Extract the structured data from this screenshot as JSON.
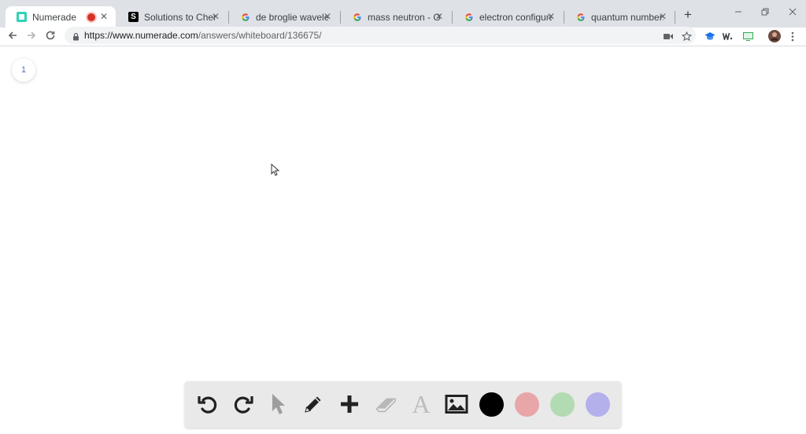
{
  "browser": {
    "tabs": [
      {
        "title": "Numerade",
        "favicon": "numerade-icon",
        "favicon_color": "#2ed3b7",
        "active": true,
        "recording": true
      },
      {
        "title": "Solutions to Chemistry",
        "favicon": "slader-icon",
        "favicon_color": "#000000"
      },
      {
        "title": "de broglie wavelength",
        "favicon": "google-icon"
      },
      {
        "title": "mass neutron - Google",
        "favicon": "google-icon"
      },
      {
        "title": "electron configuration",
        "favicon": "google-icon"
      },
      {
        "title": "quantum numbers - Go",
        "favicon": "google-icon"
      }
    ],
    "new_tab_label": "+",
    "close_glyph": "✕",
    "url_host": "https://www.numerade.com",
    "url_path": "/answers/whiteboard/136675/"
  },
  "page": {
    "page_number": "1"
  },
  "whiteboard_toolbar": {
    "tools": [
      "undo-icon",
      "redo-icon",
      "select-icon",
      "pencil-icon",
      "plus-icon",
      "eraser-icon",
      "text-icon",
      "image-icon"
    ],
    "text_tool_glyph": "A",
    "colors": [
      {
        "name": "black",
        "value": "#000000"
      },
      {
        "name": "pink",
        "value": "#e8a6a9"
      },
      {
        "name": "green",
        "value": "#b2dbb3"
      },
      {
        "name": "lavender",
        "value": "#b3b0ec"
      }
    ]
  }
}
